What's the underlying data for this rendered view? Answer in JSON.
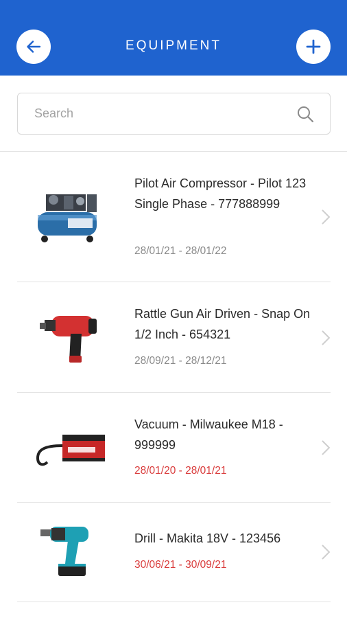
{
  "header": {
    "title": "EQUIPMENT",
    "back_icon": "arrow-left-icon",
    "add_icon": "plus-icon",
    "bg_color": "#1f63cf"
  },
  "search": {
    "placeholder": "Search",
    "value": "",
    "icon": "search-icon"
  },
  "colors": {
    "overdue": "#d93a3a",
    "normal_date": "#8a8a8a"
  },
  "items": [
    {
      "name": "Pilot Air Compressor - Pilot 123 Single Phase - 777888999",
      "dates": "28/01/21 - 28/01/22",
      "overdue": false,
      "image": "air-compressor"
    },
    {
      "name": "Rattle Gun Air Driven - Snap On 1/2 Inch - 654321",
      "dates": "28/09/21 - 28/12/21",
      "overdue": false,
      "image": "impact-wrench"
    },
    {
      "name": "Vacuum - Milwaukee M18 - 999999",
      "dates": "28/01/20 - 28/01/21",
      "overdue": true,
      "image": "vacuum"
    },
    {
      "name": "Drill -  Makita 18V - 123456",
      "dates": "30/06/21 - 30/09/21",
      "overdue": true,
      "image": "drill"
    }
  ]
}
